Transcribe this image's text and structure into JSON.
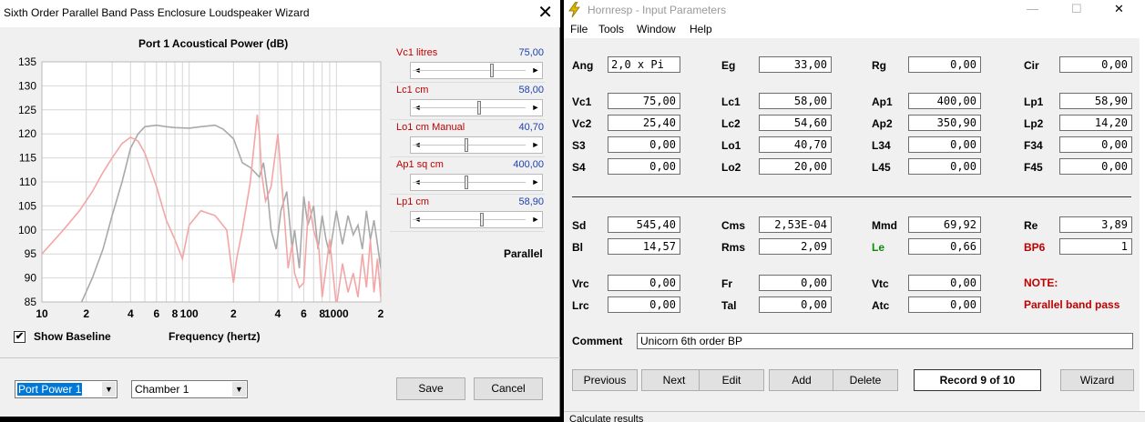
{
  "wizard": {
    "title": "Sixth Order Parallel Band Pass Enclosure Loudspeaker Wizard",
    "close_glyph": "✕",
    "sliders": [
      {
        "label": "Vc1  litres",
        "value": "75,00",
        "pos": 0.66
      },
      {
        "label": "Lc1  cm",
        "value": "58,00",
        "pos": 0.53
      },
      {
        "label": "Lo1  cm  Manual",
        "value": "40,70",
        "pos": 0.4
      },
      {
        "label": "Ap1  sq cm",
        "value": "400,00",
        "pos": 0.4
      },
      {
        "label": "Lp1  cm",
        "value": "58,90",
        "pos": 0.56
      }
    ],
    "slider_arrow_left": "◄",
    "slider_arrow_right": "►",
    "mode_label": "Parallel",
    "show_baseline": {
      "label": "Show Baseline",
      "checked": true,
      "check_glyph": "✔"
    },
    "chart_title": "Port 1 Acoustical Power (dB)",
    "x_axis_label": "Frequency (hertz)",
    "output_select": "Port Power 1",
    "chamber_select": "Chamber 1",
    "dropdown_glyph": "▼",
    "save_label": "Save",
    "cancel_label": "Cancel"
  },
  "chart_data": {
    "type": "line",
    "title": "Port 1 Acoustical Power (dB)",
    "xlabel": "Frequency (hertz)",
    "ylabel": "",
    "xscale": "log",
    "xlim": [
      10,
      2000
    ],
    "ylim": [
      85,
      135
    ],
    "yticks": [
      85,
      90,
      95,
      100,
      105,
      110,
      115,
      120,
      125,
      130,
      135
    ],
    "xtick_labels": [
      {
        "f": 10,
        "label": "10"
      },
      {
        "f": 20,
        "label": "2"
      },
      {
        "f": 40,
        "label": "4"
      },
      {
        "f": 60,
        "label": "6"
      },
      {
        "f": 80,
        "label": "8"
      },
      {
        "f": 100,
        "label": "100"
      },
      {
        "f": 200,
        "label": "2"
      },
      {
        "f": 400,
        "label": "4"
      },
      {
        "f": 600,
        "label": "6"
      },
      {
        "f": 800,
        "label": "8"
      },
      {
        "f": 1000,
        "label": "1000"
      },
      {
        "f": 2000,
        "label": "2"
      }
    ],
    "grid": true,
    "series": [
      {
        "color": "#a9a9a9",
        "x": [
          10,
          14,
          18,
          22,
          26,
          30,
          35,
          40,
          45,
          50,
          60,
          70,
          80,
          100,
          120,
          150,
          170,
          200,
          230,
          260,
          300,
          320,
          340,
          360,
          390,
          420,
          460,
          500,
          520,
          560,
          600,
          640,
          700,
          750,
          800,
          850,
          900,
          1000,
          1100,
          1200,
          1300,
          1400,
          1500,
          1600,
          1700,
          1800,
          1900,
          2000
        ],
        "y": [
          66,
          77,
          84,
          90,
          96,
          103,
          110,
          117,
          120,
          121.5,
          121.8,
          121.5,
          121.3,
          121.2,
          121.5,
          121.8,
          121,
          119,
          114,
          113,
          111,
          114,
          108,
          100,
          96,
          104,
          108,
          96,
          100,
          92,
          107,
          101,
          105,
          96,
          103,
          98,
          95,
          104,
          97,
          103,
          99,
          101,
          96,
          104,
          98,
          102,
          97,
          92
        ]
      },
      {
        "color": "#f4a5a5",
        "x": [
          10,
          14,
          18,
          22,
          26,
          30,
          35,
          40,
          45,
          50,
          60,
          70,
          80,
          90,
          100,
          120,
          150,
          180,
          200,
          210,
          230,
          260,
          290,
          300,
          310,
          330,
          360,
          400,
          440,
          470,
          500,
          520,
          560,
          600,
          650,
          700,
          760,
          800,
          850,
          900,
          1000,
          1100,
          1200,
          1300,
          1400,
          1500,
          1600,
          1700,
          1800,
          1900,
          2000
        ],
        "y": [
          95,
          100,
          104,
          108,
          112,
          115,
          118,
          119.3,
          118.5,
          116,
          109,
          102,
          98,
          94,
          101,
          104,
          103,
          100,
          89,
          94,
          100,
          110,
          124,
          120,
          112,
          106,
          109,
          120,
          104,
          92,
          97,
          91,
          88,
          89,
          106,
          100,
          96,
          86,
          92,
          98,
          84,
          93,
          87,
          91,
          86,
          95,
          88,
          98,
          87,
          94,
          86
        ]
      }
    ]
  },
  "hornresp": {
    "title": "Hornresp - Input Parameters",
    "logo_glyph": "⚡",
    "window_controls": {
      "minimize": "—",
      "maximize": "☐",
      "close": "✕"
    },
    "menu": [
      "File",
      "Tools",
      "Window",
      "Help"
    ],
    "params": [
      {
        "label": "Ang",
        "value": "2,0 x Pi",
        "align": "left"
      },
      {
        "label": "Eg",
        "value": "33,00"
      },
      {
        "label": "Rg",
        "value": "0,00"
      },
      {
        "label": "Cir",
        "value": "0,00"
      },
      {
        "label": "Vc1",
        "value": "75,00"
      },
      {
        "label": "Lc1",
        "value": "58,00"
      },
      {
        "label": "Ap1",
        "value": "400,00"
      },
      {
        "label": "Lp1",
        "value": "58,90"
      },
      {
        "label": "Vc2",
        "value": "25,40"
      },
      {
        "label": "Lc2",
        "value": "54,60"
      },
      {
        "label": "Ap2",
        "value": "350,90"
      },
      {
        "label": "Lp2",
        "value": "14,20"
      },
      {
        "label": "S3",
        "value": "0,00"
      },
      {
        "label": "Lo1",
        "value": "40,70"
      },
      {
        "label": "L34",
        "value": "0,00"
      },
      {
        "label": "F34",
        "value": "0,00"
      },
      {
        "label": "S4",
        "value": "0,00"
      },
      {
        "label": "Lo2",
        "value": "20,00"
      },
      {
        "label": "L45",
        "value": "0,00"
      },
      {
        "label": "F45",
        "value": "0,00"
      },
      {
        "label": "Sd",
        "value": "545,40"
      },
      {
        "label": "Cms",
        "value": "2,53E-04"
      },
      {
        "label": "Mmd",
        "value": "69,92"
      },
      {
        "label": "Re",
        "value": "3,89"
      },
      {
        "label": "Bl",
        "value": "14,57"
      },
      {
        "label": "Rms",
        "value": "2,09"
      },
      {
        "label": "Le",
        "value": "0,66",
        "color": "green"
      },
      {
        "label": "BP6",
        "value": "1",
        "color": "red"
      },
      {
        "label": "Vrc",
        "value": "0,00"
      },
      {
        "label": "Fr",
        "value": "0,00"
      },
      {
        "label": "Vtc",
        "value": "0,00"
      },
      {
        "label": "Lrc",
        "value": "0,00"
      },
      {
        "label": "Tal",
        "value": "0,00"
      },
      {
        "label": "Atc",
        "value": "0,00"
      }
    ],
    "note_title": "NOTE:",
    "note_text": "Parallel band pass",
    "comment_label": "Comment",
    "comment": "Unicorn 6th order BP",
    "buttons": [
      "Previous",
      "Next",
      "Edit",
      "Add",
      "Delete",
      "Wizard"
    ],
    "record": "Record 9 of 10",
    "status": "Calculate results"
  }
}
